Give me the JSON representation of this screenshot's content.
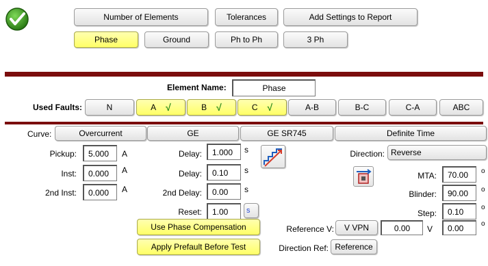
{
  "colors": {
    "accent_bar": "#7b0d0d",
    "selected_yellow": "#ffff66",
    "ok_green": "#3a9b1c"
  },
  "top": {
    "number_of_elements": "Number of Elements",
    "tolerances": "Tolerances",
    "add_settings": "Add Settings to Report",
    "tabs": {
      "phase": "Phase",
      "ground": "Ground",
      "ph_to_ph": "Ph to Ph",
      "three_ph": "3 Ph"
    },
    "selected_tab": "Phase"
  },
  "element": {
    "name_label": "Element Name:",
    "name_value": "Phase"
  },
  "faults": {
    "label": "Used Faults:",
    "n": "N",
    "a": "A",
    "b": "B",
    "c": "C",
    "ab": "A-B",
    "bc": "B-C",
    "ca": "C-A",
    "abc": "ABC",
    "checkmark": "√"
  },
  "curve": {
    "label": "Curve:",
    "type": "Overcurrent",
    "manufacturer": "GE",
    "model": "GE SR745",
    "characteristic": "Definite Time"
  },
  "pickup": {
    "pickup_label": "Pickup:",
    "pickup_value": "5.000",
    "inst_label": "Inst:",
    "inst_value": "0.000",
    "inst2_label": "2nd Inst:",
    "inst2_value": "0.000",
    "unit": "A"
  },
  "delays": {
    "delay1_label": "Delay:",
    "delay1_value": "1.000",
    "delay2_label": "Delay:",
    "delay2_value": "0.10",
    "delay3_label": "2nd Delay:",
    "delay3_value": "0.00",
    "reset_label": "Reset:",
    "reset_value": "1.00",
    "unit": "s"
  },
  "direction": {
    "label": "Direction:",
    "value": "Reverse",
    "mta_label": "MTA:",
    "mta_value": "70.00",
    "blinder_label": "Blinder:",
    "blinder_value": "90.00",
    "step_label": "Step:",
    "step_value": "0.10",
    "extra_value": "0.00",
    "degree": "o"
  },
  "options": {
    "phase_comp": "Use Phase Compensation",
    "prefault": "Apply Prefault Before Test"
  },
  "reference": {
    "ref_v_label": "Reference V:",
    "ref_v_value": "V VPN",
    "ref_v_mag": "0.00",
    "ref_v_unit": "V",
    "dir_ref_label": "Direction Ref:",
    "dir_ref_button": "Reference"
  }
}
